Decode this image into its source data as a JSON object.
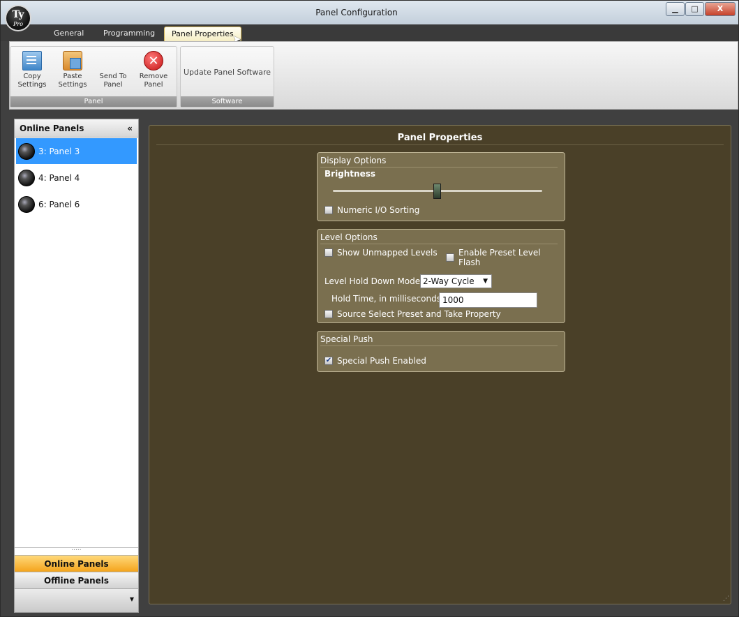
{
  "window": {
    "title": "Panel Configuration",
    "logo_line1": "Ty",
    "logo_line2": "Pro",
    "minimize_glyph": "▁",
    "maximize_glyph": "□",
    "close_glyph": "X"
  },
  "tabs": [
    {
      "label": "General",
      "active": false
    },
    {
      "label": "Programming",
      "active": false
    },
    {
      "label": "Panel Properties",
      "active": true
    }
  ],
  "ribbon": {
    "groups": [
      {
        "label": "Panel",
        "buttons": [
          {
            "label": "Copy Settings",
            "icon": "copy-icon"
          },
          {
            "label": "Paste Settings",
            "icon": "paste-icon"
          },
          {
            "label": "Send To Panel",
            "icon": "send-icon"
          },
          {
            "label": "Remove Panel",
            "icon": "remove-icon"
          }
        ]
      },
      {
        "label": "Software",
        "buttons": [
          {
            "label": "Update Panel Software",
            "icon": null
          }
        ]
      }
    ]
  },
  "left_pane": {
    "header": "Online Panels",
    "collapse_glyph": "«",
    "panels": [
      {
        "label": "3: Panel 3",
        "selected": true
      },
      {
        "label": "4: Panel 4",
        "selected": false
      },
      {
        "label": "6: Panel 6",
        "selected": false
      }
    ],
    "grip": ".....",
    "nav_online": "Online Panels",
    "nav_offline": "Offline Panels",
    "nav_more_glyph": "▼"
  },
  "main": {
    "title": "Panel Properties",
    "display_options": {
      "header": "Display Options",
      "brightness_label": "Brightness",
      "brightness_level": 0.5,
      "numeric_io_sorting": {
        "label": "Numeric I/O Sorting",
        "checked": false
      }
    },
    "level_options": {
      "header": "Level Options",
      "show_unmapped_levels": {
        "label": "Show Unmapped Levels",
        "checked": false
      },
      "enable_preset_level_flash": {
        "label": "Enable Preset Level Flash",
        "checked": false
      },
      "hold_down_mode_label": "Level Hold Down Mode:",
      "hold_down_mode_value": "2-Way Cycle",
      "dropdown_glyph": "▼",
      "hold_time_label": "Hold Time, in milliseconds:",
      "hold_time_value": "1000",
      "source_select_preset": {
        "label": "Source Select Preset and Take Property",
        "checked": false
      }
    },
    "special_push": {
      "header": "Special Push",
      "special_push_enabled": {
        "label": "Special Push Enabled",
        "checked": true
      }
    },
    "resize_grip": "⋰"
  },
  "colors": {
    "content_bg": "#4a4028",
    "group_bg": "#7a6f4f",
    "selected_item": "#3399ff",
    "active_nav": "#f4a41d"
  }
}
